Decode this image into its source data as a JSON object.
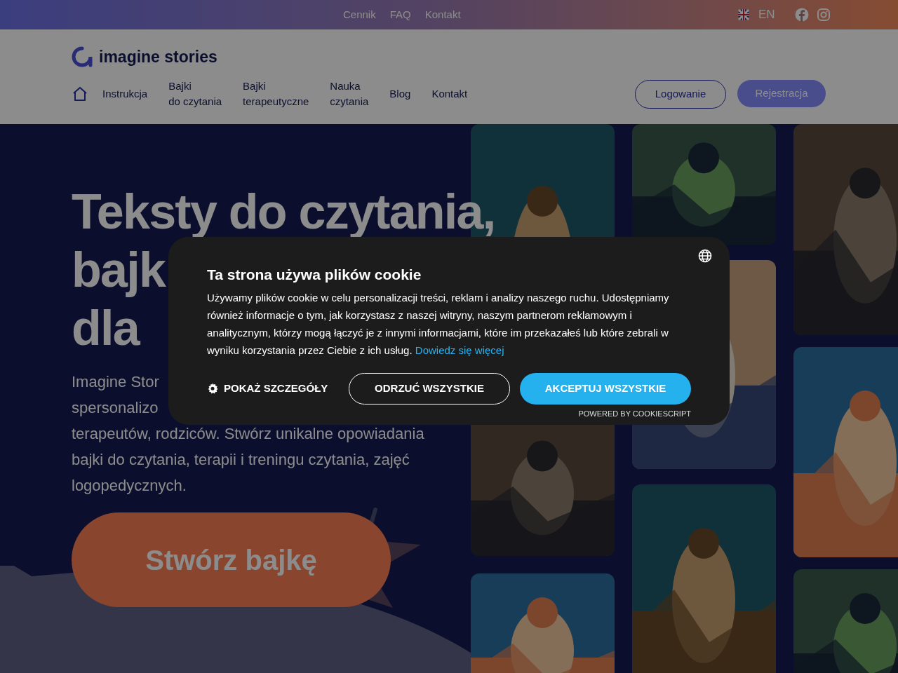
{
  "top_bar": {
    "links": [
      "Cennik",
      "FAQ",
      "Kontakt"
    ],
    "language": "EN"
  },
  "header": {
    "logo": "imagine stories",
    "nav": [
      {
        "label": "Instrukcja"
      },
      {
        "label": "Bajki\ndo czytania"
      },
      {
        "label": "Bajki\nterapeutyczne"
      },
      {
        "label": "Nauka\nczytania"
      },
      {
        "label": "Blog"
      },
      {
        "label": "Kontakt"
      }
    ],
    "login": "Logowanie",
    "register": "Rejestracja"
  },
  "hero": {
    "title_lines": [
      "Teksty do czytania,",
      "bajk",
      "dla"
    ],
    "paragraph_lines": [
      "Imagine Stor",
      "spersonalizo",
      "terapeutów, rodziców. Stwórz unikalne opowiadania",
      "bajki do czytania, terapii i treningu czytania, zajęć",
      "logopedycznych."
    ],
    "cta": "Stwórz bajkę"
  },
  "cookie_dialog": {
    "title": "Ta strona używa plików cookie",
    "text": "Używamy plików cookie w celu personalizacji treści, reklam i analizy naszego ruchu. Udostępniamy również informacje o tym, jak korzystasz z naszej witryny, naszym partnerom reklamowym i analitycznym, którzy mogą łączyć je z innymi informacjami, które im przekazałeś lub które zebrali w wyniku korzystania przez Ciebie z ich usług.",
    "link": "Dowiedz się więcej",
    "details": "POKAŻ SZCZEGÓŁY",
    "reject": "ODRZUĆ WSZYSTKIE",
    "accept": "AKCEPTUJ WSZYSTKIE",
    "powered": "POWERED BY COOKIESCRIPT"
  }
}
